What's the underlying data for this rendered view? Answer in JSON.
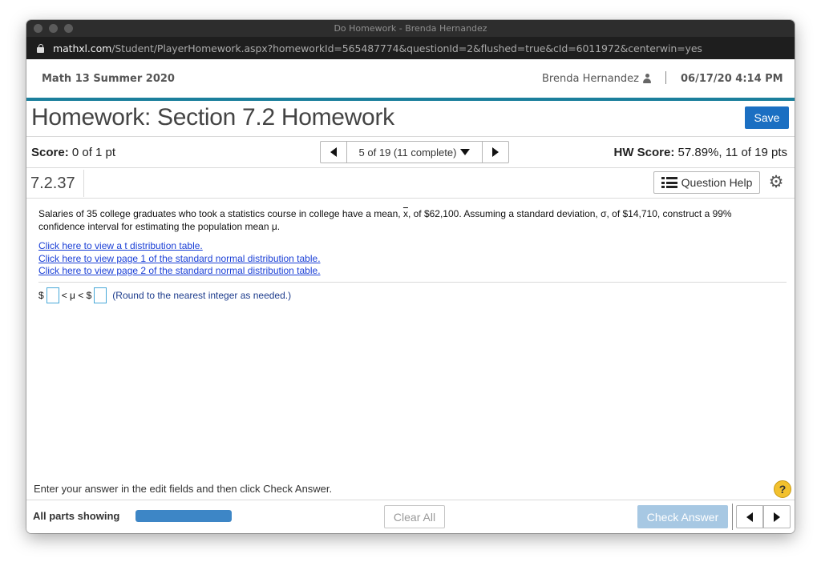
{
  "window": {
    "title": "Do Homework - Brenda Hernandez"
  },
  "browser": {
    "url_host": "mathxl.com",
    "url_path": "/Student/PlayerHomework.aspx?homeworkId=565487774&questionId=2&flushed=true&cId=6011972&centerwin=yes"
  },
  "header": {
    "course": "Math 13 Summer 2020",
    "user": "Brenda Hernandez",
    "datetime": "06/17/20 4:14 PM"
  },
  "homework": {
    "title": "Homework: Section 7.2 Homework",
    "save_label": "Save",
    "score_label": "Score:",
    "score_value": "0 of 1 pt",
    "question_select": "5 of 19 (11 complete)",
    "hw_score_label": "HW Score:",
    "hw_score_value": "57.89%, 11 of 19 pts"
  },
  "question": {
    "number": "7.2.37",
    "help_label": "Question Help",
    "text_part1": "Salaries of 35 college graduates who took a statistics course in college have a mean, ",
    "xbar": "x",
    "text_part2": ", of $62,100. Assuming a standard deviation, σ, of $14,710, construct a 99% confidence interval for estimating the population mean μ.",
    "links": [
      "Click here to view a t distribution table.",
      "Click here to view page 1 of the standard normal distribution table.",
      "Click here to view page 2 of the standard normal distribution table."
    ],
    "answer": {
      "prefix": "$",
      "middle": "< μ < $",
      "lower_value": "",
      "upper_value": "",
      "note": "(Round to the nearest integer as needed.)"
    }
  },
  "footer": {
    "instruction": "Enter your answer in the edit fields and then click Check Answer.",
    "help_symbol": "?",
    "parts_label": "All parts showing",
    "progress_fraction": 1.0,
    "clear_label": "Clear All",
    "check_label": "Check Answer"
  },
  "colors": {
    "accent_teal": "#1b7f9c",
    "save_blue": "#1b6fc2",
    "link_blue": "#1a3fd6",
    "progress_blue": "#3d86c6",
    "check_disabled": "#a7c8e3",
    "help_yellow": "#f2c12e"
  },
  "icons": [
    "lock-icon",
    "user-icon",
    "chevron-left-icon",
    "chevron-right-icon",
    "caret-down-icon",
    "list-icon",
    "gear-icon",
    "help-icon"
  ]
}
